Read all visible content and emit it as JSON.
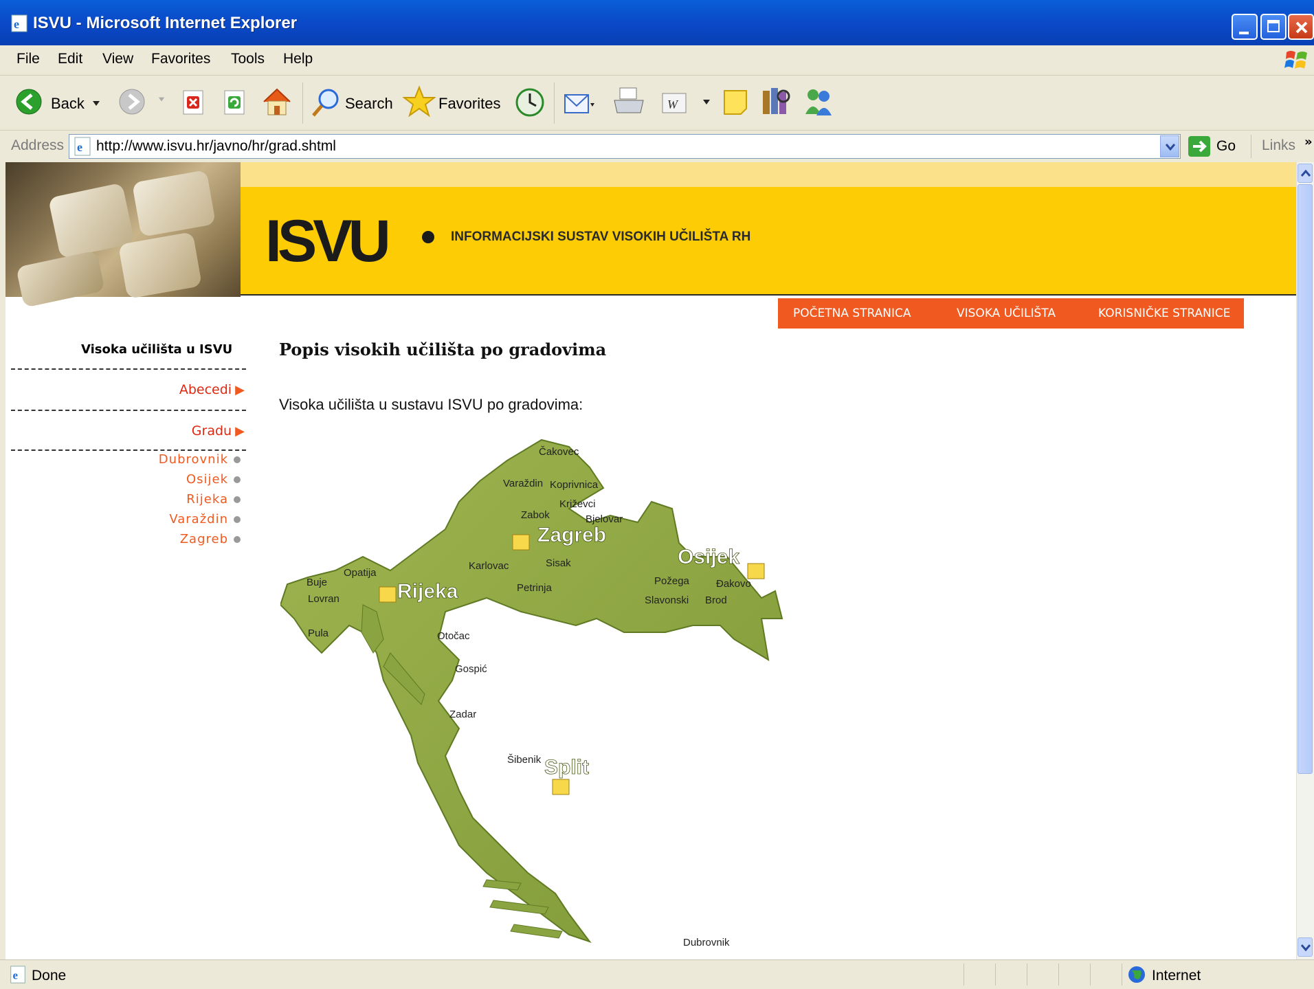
{
  "window": {
    "title": "ISVU - Microsoft Internet Explorer"
  },
  "menu": {
    "items": [
      "File",
      "Edit",
      "View",
      "Favorites",
      "Tools",
      "Help"
    ]
  },
  "toolbar": {
    "back": "Back",
    "search": "Search",
    "favorites": "Favorites"
  },
  "address": {
    "label": "Address",
    "url": "http://www.isvu.hr/javno/hr/grad.shtml",
    "go": "Go",
    "links": "Links"
  },
  "header": {
    "logo": "ISVU",
    "tagline": "INFORMACIJSKI SUSTAV VISOKIH UČILIŠTA RH"
  },
  "nav": {
    "items": [
      "POČETNA STRANICA",
      "VISOKA UČILIŠTA",
      "KORISNIČKE STRANICE"
    ]
  },
  "sidebar": {
    "title": "Visoka učilišta u ISVU",
    "links": [
      "Abecedi",
      "Gradu"
    ],
    "cities": [
      "Dubrovnik",
      "Osijek",
      "Rijeka",
      "Varaždin",
      "Zagreb"
    ]
  },
  "main": {
    "title": "Popis visokih učilišta po gradovima",
    "desc": "Visoka učilišta u sustavu ISVU po gradovima:"
  },
  "map": {
    "major_cities": [
      "Zagreb",
      "Osijek",
      "Rijeka",
      "Split"
    ],
    "minor_towns": [
      "Čakovec",
      "Varaždin",
      "Koprivnica",
      "Križevci",
      "Zabok",
      "Bjelovar",
      "Karlovac",
      "Sisak",
      "Petrinja",
      "Opatija",
      "Buje",
      "Lovran",
      "Pula",
      "Požega",
      "Đakovo",
      "Slavonski",
      "Brod",
      "Otočac",
      "Gospić",
      "Zadar",
      "Šibenik",
      "Dubrovnik"
    ]
  },
  "status": {
    "text": "Done",
    "zone": "Internet"
  }
}
